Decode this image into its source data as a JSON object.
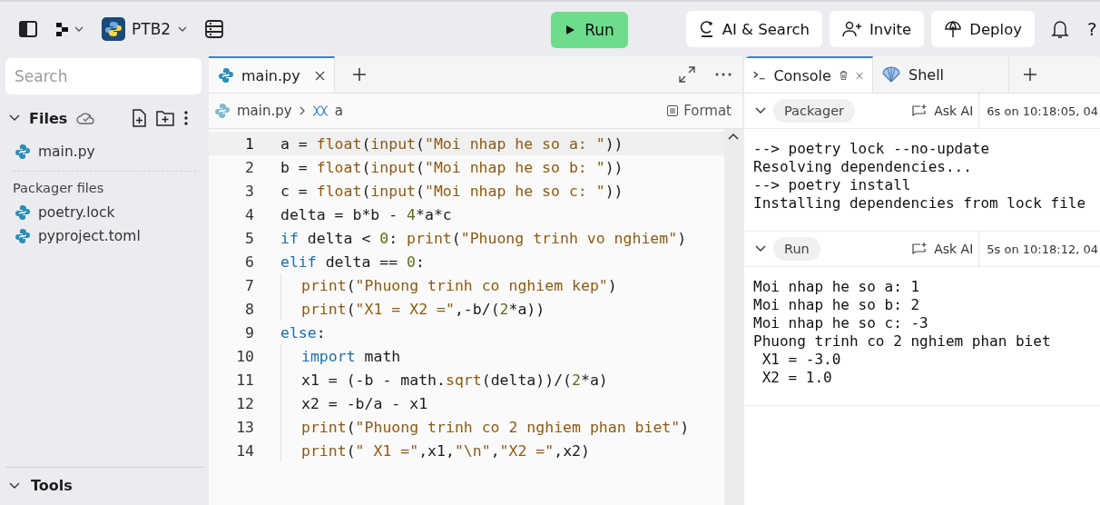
{
  "topbar": {
    "project": "PTB2",
    "run_button": "Run",
    "actions": [
      {
        "kind": "ai",
        "label": "AI & Search"
      },
      {
        "kind": "invite",
        "label": "Invite"
      },
      {
        "kind": "deploy",
        "label": "Deploy"
      }
    ],
    "help": "?"
  },
  "sidebar": {
    "search": {
      "placeholder": "Search"
    },
    "files_title": "Files",
    "files": [
      {
        "name": "main.py"
      }
    ],
    "packager_title": "Packager files",
    "packager_files": [
      {
        "name": "poetry.lock"
      },
      {
        "name": "pyproject.toml"
      }
    ],
    "tools_title": "Tools"
  },
  "editor": {
    "tabs": [
      {
        "label": "main.py",
        "selected": true
      }
    ],
    "breadcrumb": {
      "file": "main.py",
      "symbol": "a"
    },
    "format_button": "Format",
    "lines": [
      {
        "number": "1",
        "selected": true,
        "indented": false,
        "tokens": [
          {
            "kind": "plain",
            "text": "a = "
          },
          {
            "kind": "fn",
            "text": "float"
          },
          {
            "kind": "plain",
            "text": "("
          },
          {
            "kind": "fn",
            "text": "input"
          },
          {
            "kind": "plain",
            "text": "("
          },
          {
            "kind": "str",
            "text": "\"Moi nhap he so a: \""
          },
          {
            "kind": "plain",
            "text": "))"
          }
        ]
      },
      {
        "number": "2",
        "selected": false,
        "indented": false,
        "tokens": [
          {
            "kind": "plain",
            "text": "b = "
          },
          {
            "kind": "fn",
            "text": "float"
          },
          {
            "kind": "plain",
            "text": "("
          },
          {
            "kind": "fn",
            "text": "input"
          },
          {
            "kind": "plain",
            "text": "("
          },
          {
            "kind": "str",
            "text": "\"Moi nhap he so b: \""
          },
          {
            "kind": "plain",
            "text": "))"
          }
        ]
      },
      {
        "number": "3",
        "selected": false,
        "indented": false,
        "tokens": [
          {
            "kind": "plain",
            "text": "c = "
          },
          {
            "kind": "fn",
            "text": "float"
          },
          {
            "kind": "plain",
            "text": "("
          },
          {
            "kind": "fn",
            "text": "input"
          },
          {
            "kind": "plain",
            "text": "("
          },
          {
            "kind": "str",
            "text": "\"Moi nhap he so c: \""
          },
          {
            "kind": "plain",
            "text": "))"
          }
        ]
      },
      {
        "number": "4",
        "selected": false,
        "indented": false,
        "tokens": [
          {
            "kind": "plain",
            "text": "delta = b*b - "
          },
          {
            "kind": "num",
            "text": "4"
          },
          {
            "kind": "plain",
            "text": "*a*c"
          }
        ]
      },
      {
        "number": "5",
        "selected": false,
        "indented": false,
        "tokens": [
          {
            "kind": "kw",
            "text": "if"
          },
          {
            "kind": "plain",
            "text": " delta < "
          },
          {
            "kind": "num",
            "text": "0"
          },
          {
            "kind": "plain",
            "text": ": "
          },
          {
            "kind": "fn",
            "text": "print"
          },
          {
            "kind": "plain",
            "text": "("
          },
          {
            "kind": "str",
            "text": "\"Phuong trinh vo nghiem\""
          },
          {
            "kind": "plain",
            "text": ")"
          }
        ]
      },
      {
        "number": "6",
        "selected": false,
        "indented": false,
        "tokens": [
          {
            "kind": "kw",
            "text": "elif"
          },
          {
            "kind": "plain",
            "text": " delta == "
          },
          {
            "kind": "num",
            "text": "0"
          },
          {
            "kind": "plain",
            "text": ":"
          }
        ]
      },
      {
        "number": "7",
        "selected": false,
        "indented": true,
        "tokens": [
          {
            "kind": "fn",
            "text": "print"
          },
          {
            "kind": "plain",
            "text": "("
          },
          {
            "kind": "str",
            "text": "\"Phuong trinh co nghiem kep\""
          },
          {
            "kind": "plain",
            "text": ")"
          }
        ]
      },
      {
        "number": "8",
        "selected": false,
        "indented": true,
        "tokens": [
          {
            "kind": "fn",
            "text": "print"
          },
          {
            "kind": "plain",
            "text": "("
          },
          {
            "kind": "str",
            "text": "\"X1 = X2 =\""
          },
          {
            "kind": "plain",
            "text": ",-b/("
          },
          {
            "kind": "num",
            "text": "2"
          },
          {
            "kind": "plain",
            "text": "*a))"
          }
        ]
      },
      {
        "number": "9",
        "selected": false,
        "indented": false,
        "tokens": [
          {
            "kind": "kw",
            "text": "else"
          },
          {
            "kind": "plain",
            "text": ":"
          }
        ]
      },
      {
        "number": "10",
        "selected": false,
        "indented": true,
        "tokens": [
          {
            "kind": "kw",
            "text": "import"
          },
          {
            "kind": "plain",
            "text": " math"
          }
        ]
      },
      {
        "number": "11",
        "selected": false,
        "indented": true,
        "tokens": [
          {
            "kind": "plain",
            "text": "x1 = (-b - math."
          },
          {
            "kind": "fn",
            "text": "sqrt"
          },
          {
            "kind": "plain",
            "text": "(delta))/("
          },
          {
            "kind": "num",
            "text": "2"
          },
          {
            "kind": "plain",
            "text": "*a)"
          }
        ]
      },
      {
        "number": "12",
        "selected": false,
        "indented": true,
        "tokens": [
          {
            "kind": "plain",
            "text": "x2 = -b/a - x1"
          }
        ]
      },
      {
        "number": "13",
        "selected": false,
        "indented": true,
        "tokens": [
          {
            "kind": "fn",
            "text": "print"
          },
          {
            "kind": "plain",
            "text": "("
          },
          {
            "kind": "str",
            "text": "\"Phuong trinh co 2 nghiem phan biet\""
          },
          {
            "kind": "plain",
            "text": ")"
          }
        ]
      },
      {
        "number": "14",
        "selected": false,
        "indented": true,
        "tokens": [
          {
            "kind": "fn",
            "text": "print"
          },
          {
            "kind": "plain",
            "text": "("
          },
          {
            "kind": "str",
            "text": "\" X1 =\""
          },
          {
            "kind": "plain",
            "text": ",x1,"
          },
          {
            "kind": "str",
            "text": "\"\\n\""
          },
          {
            "kind": "plain",
            "text": ","
          },
          {
            "kind": "str",
            "text": "\"X2 =\""
          },
          {
            "kind": "plain",
            "text": ",x2)"
          }
        ]
      }
    ]
  },
  "console": {
    "tabs": [
      {
        "kind": "console",
        "label": "Console",
        "selected": true
      },
      {
        "kind": "shell",
        "label": "Shell",
        "selected": false
      }
    ],
    "sections": [
      {
        "label": "Packager",
        "ask_ai": "Ask AI",
        "time": "6s on 10:18:05, 04",
        "output": [
          "--> poetry lock --no-update",
          "Resolving dependencies...",
          "--> poetry install",
          "Installing dependencies from lock file"
        ]
      },
      {
        "label": "Run",
        "ask_ai": "Ask AI",
        "time": "5s on 10:18:12, 04",
        "output": [
          "Moi nhap he so a: 1",
          "Moi nhap he so b: 2",
          "Moi nhap he so c: -3",
          "Phuong trinh co 2 nghiem phan biet",
          " X1 = -3.0",
          " X2 = 1.0"
        ]
      }
    ]
  }
}
